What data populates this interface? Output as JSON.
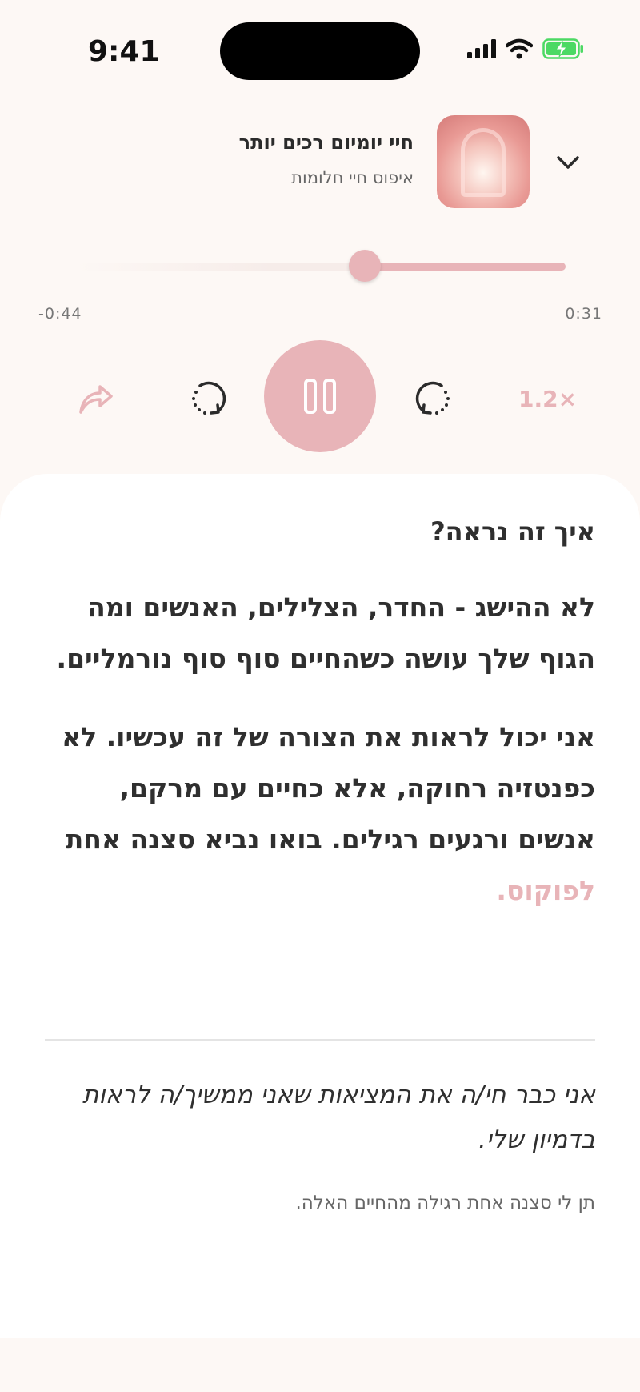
{
  "status_bar": {
    "time": "9:41",
    "icons": [
      "cellular-signal-icon",
      "wifi-icon",
      "battery-charging-icon"
    ],
    "battery_color": "#4cd964"
  },
  "player": {
    "title": "חיי יומיום רכים יותר",
    "subtitle": "איפוס חיי חלומות",
    "progress": {
      "elapsed": "0:31",
      "remaining": "-0:44",
      "fraction": 0.41
    },
    "controls": {
      "speed": "1.2×",
      "icons": [
        "share-icon",
        "rewind-icon",
        "pause-icon",
        "forward-icon",
        "chevron-down-icon"
      ]
    },
    "accent_color": "#e8b4b8"
  },
  "content": {
    "heading": "איך זה נראה?",
    "paragraph1": "לא ההישג - החדר, הצלילים, האנשים ומה הגוף שלך עושה כשהחיים סוף סוף נורמליים.",
    "paragraph2": "אני יכול לראות את הצורה של זה עכשיו. לא כפנטזיה רחוקה, אלא כחיים עם מרקם, אנשים ורגעים רגילים. בואו נביא סצנה אחת",
    "paragraph2_accent": "לפוקוס.",
    "quote": "אני כבר חי/ה את המציאות שאני ממשיך/ה לראות בדמיון שלי.",
    "caption": "תן לי סצנה אחת רגילה מהחיים האלה."
  }
}
